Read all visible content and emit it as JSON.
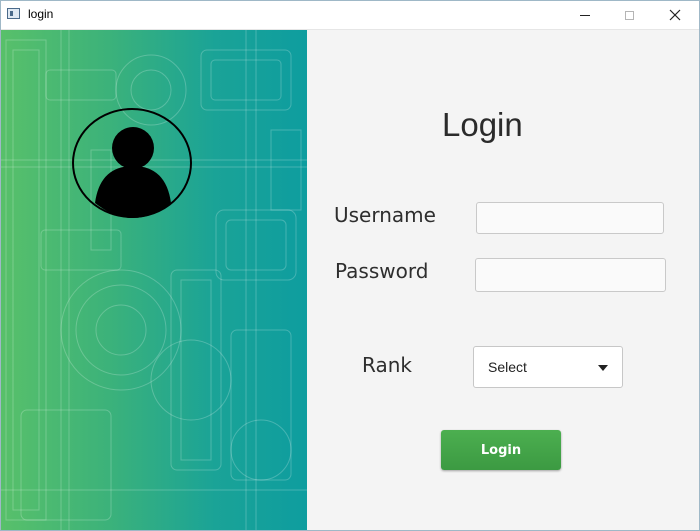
{
  "window": {
    "title": "login",
    "app_icon": "window-app-icon",
    "controls": [
      "minimize-icon",
      "maximize-icon",
      "close-icon"
    ]
  },
  "left_panel": {
    "background": "industrial-machinery-line-art",
    "avatar_icon": "user-avatar-icon",
    "gradient_colors": [
      "#58c06a",
      "#0e9d9f"
    ]
  },
  "form": {
    "heading": "Login",
    "username_label": "Username",
    "username_value": "",
    "password_label": "Password",
    "password_value": "",
    "rank_label": "Rank",
    "rank_selected": "Select",
    "submit_label": "Login"
  },
  "colors": {
    "accent": "#43a047",
    "panel_bg": "#f4f4f4"
  }
}
